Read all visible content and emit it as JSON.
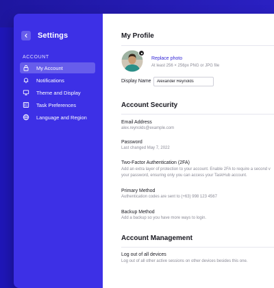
{
  "sidebar": {
    "title": "Settings",
    "section_label": "ACCOUNT",
    "items": [
      {
        "label": "My Account",
        "icon": "lock-icon",
        "active": true
      },
      {
        "label": "Notifications",
        "icon": "bell-icon",
        "active": false
      },
      {
        "label": "Theme and Display",
        "icon": "monitor-icon",
        "active": false
      },
      {
        "label": "Task Preferences",
        "icon": "checklist-icon",
        "active": false
      },
      {
        "label": "Language and Region",
        "icon": "globe-icon",
        "active": false
      }
    ]
  },
  "profile": {
    "heading": "My Profile",
    "replace_photo": "Replace photo",
    "photo_hint": "At least 256 × 256px PNG or JPG file",
    "display_name_label": "Display Name",
    "display_name_value": "Alexander Reynolds"
  },
  "security": {
    "heading": "Account Security",
    "email_title": "Email Address",
    "email_value": "alex.reynolds@example.com",
    "password_title": "Password",
    "password_sub": "Last changed May 7, 2022",
    "twofa_title": "Two-Factor Authentication (2FA)",
    "twofa_line1": "Add an extra layer of protection to your account. Enable 2FA to require a second v",
    "twofa_line2": "your password, ensuring only you can access your TaskHub account.",
    "primary_title": "Primary Method",
    "primary_sub": "Authentication codes are sent to (+63) 998 123 4567",
    "backup_title": "Backup Method",
    "backup_sub": "Add a backup so you have more ways to login."
  },
  "management": {
    "heading": "Account Management",
    "logout_title": "Log out of all devices",
    "logout_sub": "Log out of all other active sessions on other devices besides this one."
  },
  "colors": {
    "background": "#1f16b8",
    "sidebar": "#3d30e6",
    "accent": "#3427d6"
  }
}
